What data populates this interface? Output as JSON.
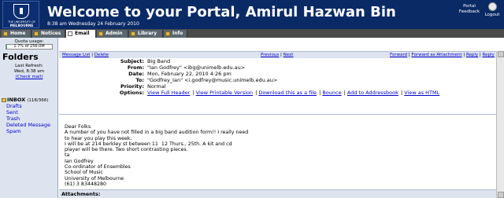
{
  "header": {
    "logo_line1": "THE UNIVERSITY OF",
    "logo_line2": "MELBOURNE",
    "title": "Welcome to your Portal, Amirul Hazwan Bin",
    "subtitle": "8:38 am Wednesday 24 February 2010",
    "portal_feedback": "Portal Feedback",
    "logout": "Logout"
  },
  "tabs": [
    {
      "label": "Home",
      "icon": "home-icon",
      "active": false
    },
    {
      "label": "Notices",
      "icon": "notices-icon",
      "active": false
    },
    {
      "label": "Email",
      "icon": "email-icon",
      "active": true
    },
    {
      "label": "Admin",
      "icon": "admin-icon",
      "active": false
    },
    {
      "label": "Library",
      "icon": "library-icon",
      "active": false
    },
    {
      "label": "Info",
      "icon": "info-icon",
      "active": false
    }
  ],
  "sidebar": {
    "quota_label": "Quota usage:",
    "quota_text": "1.7% of 256.0M",
    "quota_fraction": 0.017,
    "folders_heading": "Folders",
    "last_refresh_label": "Last Refresh:",
    "last_refresh_time": "Wed, 8:38 am",
    "check_mail": "(Check mail)",
    "folders": [
      {
        "name": "INBOX",
        "count": "(118/366)"
      },
      {
        "name": "Drafts",
        "count": ""
      },
      {
        "name": "Sent",
        "count": ""
      },
      {
        "name": "Trash",
        "count": ""
      },
      {
        "name": "Deleted Message",
        "count": ""
      },
      {
        "name": "Spam",
        "count": ""
      }
    ]
  },
  "nav": {
    "message_list": "Message List",
    "delete": "Delete",
    "previous": "Previous",
    "next": "Next",
    "forward": "Forward",
    "forward_attachment": "Forward as Attachment",
    "reply": "Reply",
    "reply_all": "Reply All"
  },
  "message": {
    "subject_label": "Subject:",
    "subject": "Big Band",
    "from_label": "From:",
    "from": "\"Ian Godfrey\" <ibg@unimelb.edu.au>",
    "date_label": "Date:",
    "date": "Mon, February 22, 2010 4:26 pm",
    "to_label": "To:",
    "to": "\"Godfrey_Ian\" <i.godfrey@music.unimelb.edu.au>",
    "priority_label": "Priority:",
    "priority": "Normal",
    "options_label": "Options:",
    "options": [
      "View Full Header",
      "View Printable Version",
      "Download this as a file",
      "Bounce",
      "Add to Addressbook",
      "View as HTML"
    ],
    "body": "Dear Folks\nA number of you have not filled in a big band audition form!! I really need\nto hear you play this week.\nI will be at 214 berkley st between 11  12 Thurs., 25th. A kit and cd\nplayer will be there. Two short contrasting pieces.\nta\nIan Godfrey\nCo-ordinator of Ensembles\nSchool of Music\nUniversity of Melbourne\n(61) 3 83448280",
    "attachments_label": "Attachments:"
  }
}
